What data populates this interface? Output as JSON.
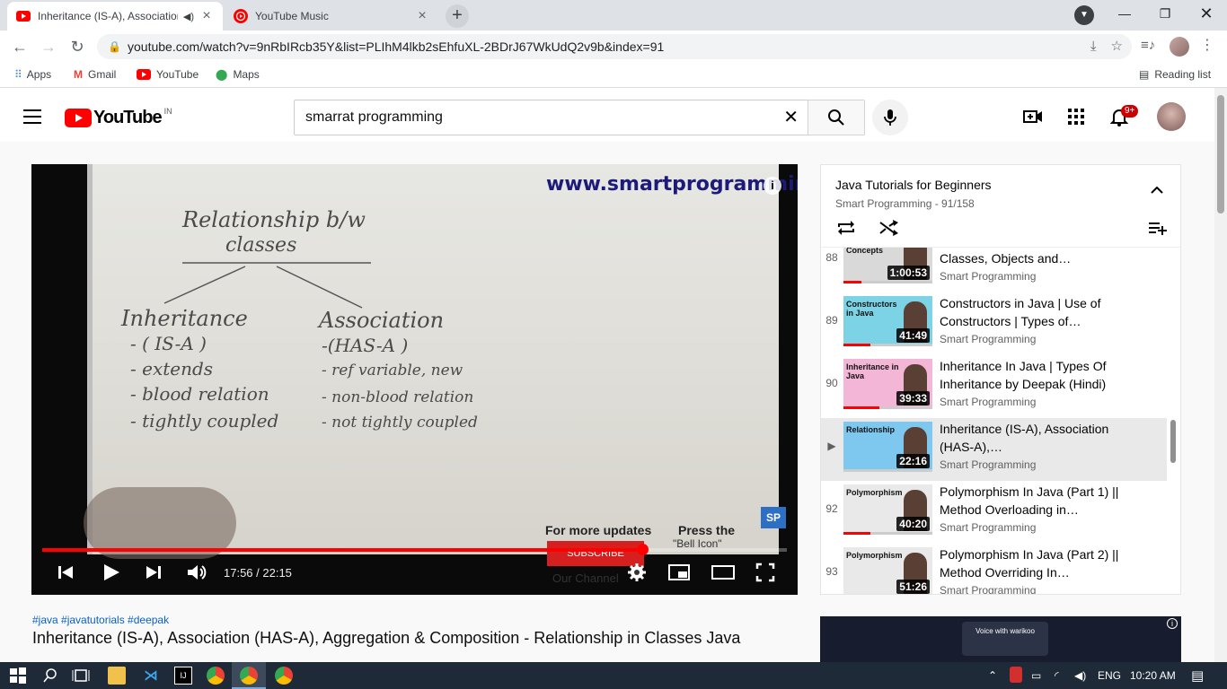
{
  "browser": {
    "tabs": [
      {
        "title": "Inheritance (IS-A), Association",
        "active": true
      },
      {
        "title": "YouTube Music",
        "active": false
      }
    ],
    "url": "youtube.com/watch?v=9nRbIRcb35Y&list=PLIhM4lkb2sEhfuXL-2BDrJ67WkUdQ2v9b&index=91",
    "bookmarks": [
      "Apps",
      "Gmail",
      "YouTube",
      "Maps"
    ],
    "reading_list": "Reading list"
  },
  "youtube": {
    "logo_text": "YouTube",
    "country": "IN",
    "search_value": "smarrat programming",
    "notification_badge": "9+"
  },
  "player": {
    "board_url": "www.smartprogramming.in",
    "board_text": {
      "heading1": "Relationship b/w",
      "heading2": "classes",
      "left_col": [
        "Inheritance",
        "- ( IS-A )",
        "- extends",
        "- blood relation",
        "- tightly coupled"
      ],
      "right_col": [
        "Association",
        "-(HAS-A )",
        "- ref variable, new",
        "- non-blood relation",
        "- not tightly coupled"
      ]
    },
    "overlay_left": "For more updates",
    "overlay_right": "Press the",
    "overlay_bell": "\"Bell Icon\"",
    "overlay_channel": "Our Channel",
    "overlay_subscribe": "SUBSCRIBE",
    "time": "17:56 / 22:15",
    "progress_fraction": 0.806
  },
  "video": {
    "tags": "#java #javatutorials #deepak",
    "title": "Inheritance (IS-A), Association (HAS-A), Aggregation & Composition - Relationship in Classes Java"
  },
  "playlist": {
    "title": "Java Tutorials for Beginners",
    "subtitle": "Smart Programming - 91/158",
    "items": [
      {
        "index": "88",
        "title": "Java OOPs Concepts - Classes, Objects and…",
        "channel": "Smart Programming",
        "duration": "1:00:53",
        "thumb_label": "OOPs Concepts",
        "watched": 0.2
      },
      {
        "index": "89",
        "title": "Constructors in Java | Use of Constructors | Types of…",
        "channel": "Smart Programming",
        "duration": "41:49",
        "thumb_label": "Constructors in Java",
        "watched": 0.3
      },
      {
        "index": "90",
        "title": "Inheritance In Java | Types Of Inheritance by Deepak (Hindi)",
        "channel": "Smart Programming",
        "duration": "39:33",
        "thumb_label": "Inheritance in Java",
        "watched": 0.4
      },
      {
        "index": "▶",
        "title": "Inheritance (IS-A), Association (HAS-A),…",
        "channel": "Smart Programming",
        "duration": "22:16",
        "thumb_label": "Relationship",
        "watched": 0.0
      },
      {
        "index": "92",
        "title": "Polymorphism In Java (Part 1) || Method Overloading in…",
        "channel": "Smart Programming",
        "duration": "40:20",
        "thumb_label": "Polymorphism",
        "watched": 0.3
      },
      {
        "index": "93",
        "title": "Polymorphism In Java (Part 2) || Method Overriding In…",
        "channel": "Smart Programming",
        "duration": "51:26",
        "thumb_label": "Polymorphism",
        "watched": 0.2
      }
    ]
  },
  "ad": {
    "text": "Voice with warikoo"
  },
  "taskbar": {
    "lang": "ENG",
    "time": "10:20 AM"
  },
  "colors": {
    "youtube_red": "#ff0000",
    "link_blue": "#065fd4"
  }
}
